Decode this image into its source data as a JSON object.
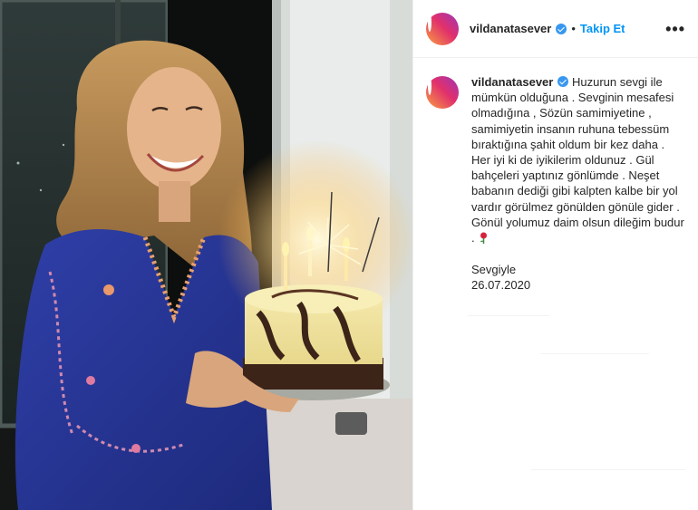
{
  "post": {
    "author": {
      "username": "vildanatasever",
      "verified": true,
      "avatar_icon": "profile-avatar"
    },
    "header": {
      "separator": "•",
      "follow_label": "Takip Et",
      "more_icon": "more-options-icon",
      "more_label": "•••"
    },
    "caption": {
      "text": "Huzurun sevgi ile mümkün olduğuna . Sevginin mesafesi olmadığına , Sözün samimiyetine , samimiyetin insanın ruhuna tebessüm bıraktığına şahit oldum bir kez daha . Her iyi ki de iyikilerim oldunuz . Gül bahçeleri yaptınız gönlümde . Neşet babanın dediği gibi kalpten kalbe bir yol vardır görülmez gönülden gönüle gider . Gönül yolumuz daim olsun dileğim budur .",
      "emoji_icon": "rose-emoji",
      "signoff": "Sevgiyle",
      "date": "26.07.2020"
    },
    "colors": {
      "link": "#0095f6",
      "verified": "#3897f0",
      "text": "#262626",
      "border": "#efefef"
    }
  }
}
